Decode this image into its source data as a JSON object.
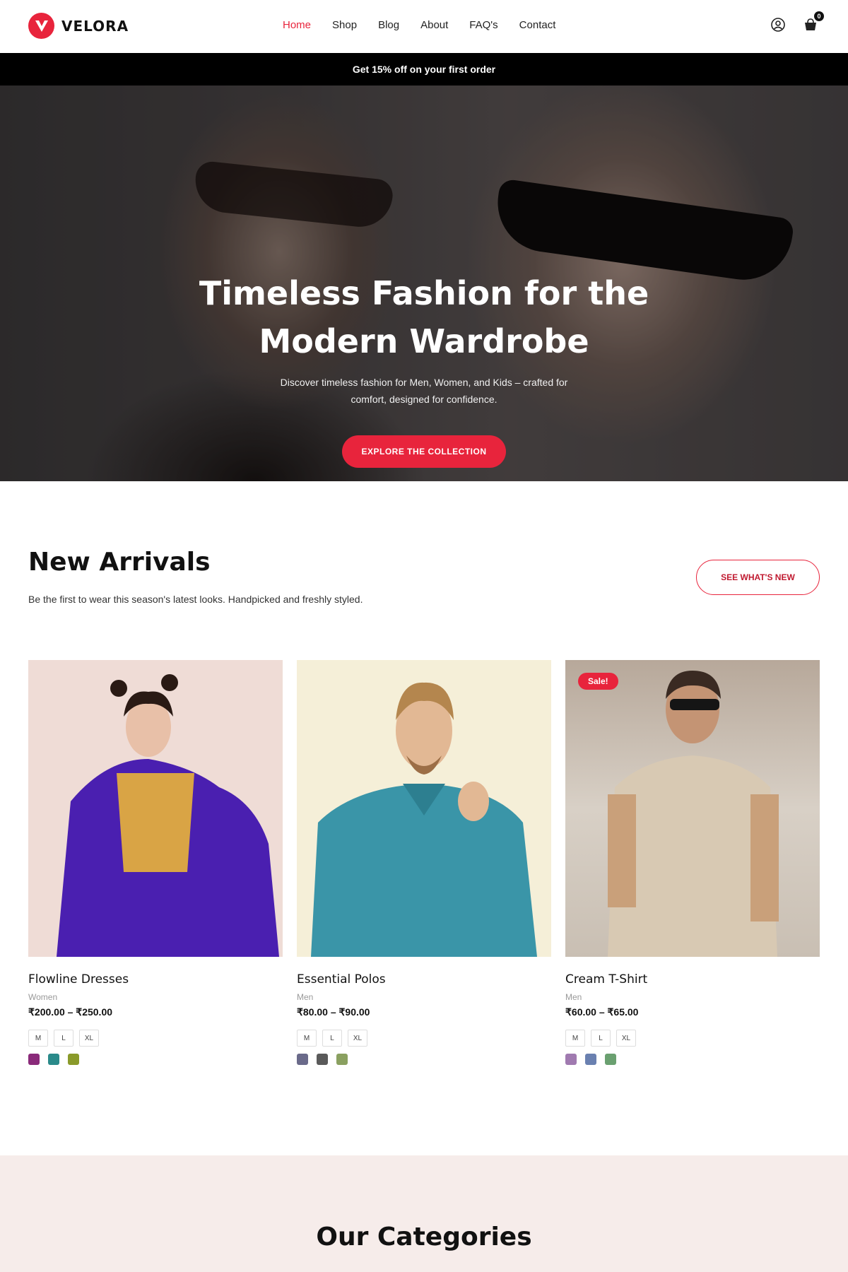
{
  "brand": {
    "name": "VELORA",
    "accent": "#e8243c"
  },
  "nav": {
    "items": [
      {
        "label": "Home",
        "active": true
      },
      {
        "label": "Shop",
        "active": false
      },
      {
        "label": "Blog",
        "active": false
      },
      {
        "label": "About",
        "active": false
      },
      {
        "label": "FAQ's",
        "active": false
      },
      {
        "label": "Contact",
        "active": false
      }
    ],
    "icons": [
      "user-icon",
      "cart-icon"
    ],
    "cart_count": "0"
  },
  "promo": {
    "text": "Get 15% off on your first order"
  },
  "hero": {
    "title_line1": "Timeless Fashion for the",
    "title_line2": "Modern Wardrobe",
    "subtitle_line1": "Discover timeless fashion for Men, Women, and Kids – crafted for",
    "subtitle_line2": "comfort, designed for confidence.",
    "cta": "EXPLORE THE COLLECTION"
  },
  "arrivals": {
    "title": "New Arrivals",
    "subtitle": "Be the first to wear this season's latest looks. Handpicked and freshly styled.",
    "cta": "SEE WHAT'S NEW",
    "products": [
      {
        "name": "Flowline Dresses",
        "category": "Women",
        "price": "₹200.00 – ₹250.00",
        "sizes": [
          "M",
          "L",
          "XL"
        ],
        "colors": [
          "#8a2a7a",
          "#2a8a8a",
          "#8a9a2a"
        ],
        "badge": ""
      },
      {
        "name": "Essential Polos",
        "category": "Men",
        "price": "₹80.00 – ₹90.00",
        "sizes": [
          "M",
          "L",
          "XL"
        ],
        "colors": [
          "#6a6a8a",
          "#5a5a5a",
          "#8aa060"
        ],
        "badge": ""
      },
      {
        "name": "Cream T-Shirt",
        "category": "Men",
        "price": "₹60.00 – ₹65.00",
        "sizes": [
          "M",
          "L",
          "XL"
        ],
        "colors": [
          "#a07ab0",
          "#6a80b0",
          "#6aa070"
        ],
        "badge": "Sale!"
      }
    ]
  },
  "categories": {
    "title": "Our Categories"
  }
}
